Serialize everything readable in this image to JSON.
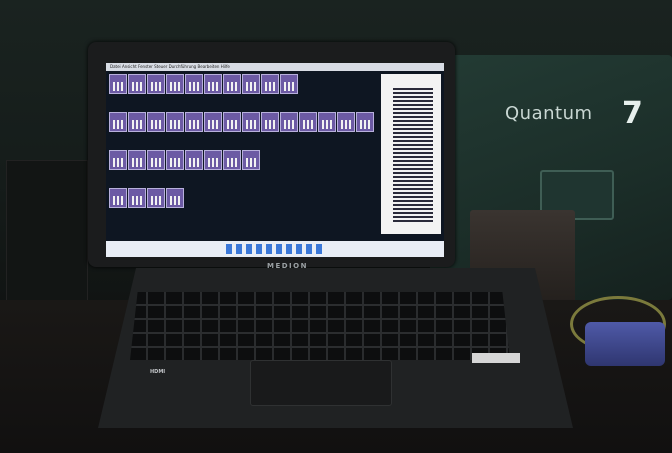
{
  "scene": {
    "description_tags": [
      "laptop",
      "stage",
      "lighting-control-software"
    ],
    "laptop_brand": "MEDION",
    "port_label": "HDMI",
    "rack_logo": {
      "text": "Quantum",
      "number": "7"
    }
  },
  "screen": {
    "menubar_text": "Datei Ansicht Fenster Steuer Durchführung Bearbeiten Hilfe"
  },
  "colors": {
    "cell_fill": "#6c5aa4",
    "screen_bg": "#0e1622",
    "rack": "#233b34"
  }
}
